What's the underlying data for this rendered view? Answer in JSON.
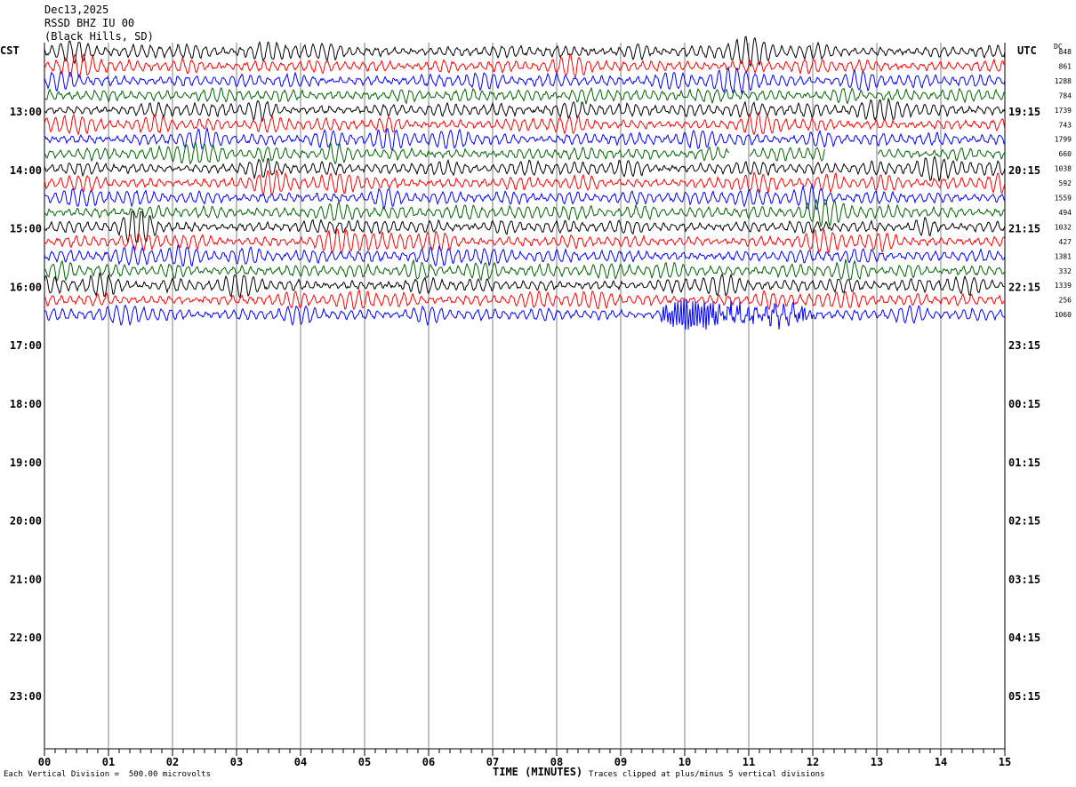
{
  "header": {
    "date": "Dec13,2025",
    "station": "RSSD BHZ IU 00",
    "location": "(Black Hills, SD)"
  },
  "chart_data": {
    "type": "line",
    "left_axis_label": "CST",
    "right_axis_label": "UTC",
    "dc_label": "DC",
    "x_axis_title": "TIME (MINUTES)",
    "x_ticks": [
      "00",
      "01",
      "02",
      "03",
      "04",
      "05",
      "06",
      "07",
      "08",
      "09",
      "10",
      "11",
      "12",
      "13",
      "14",
      "15"
    ],
    "xlim": [
      0,
      15
    ],
    "left_hour_labels": [
      "13:00",
      "14:00",
      "15:00",
      "16:00",
      "17:00",
      "18:00",
      "19:00",
      "20:00",
      "21:00",
      "22:00",
      "23:00"
    ],
    "right_hour_labels": [
      "19:15",
      "20:15",
      "21:15",
      "22:15",
      "23:15",
      "00:15",
      "01:15",
      "02:15",
      "03:15",
      "04:15",
      "05:15"
    ],
    "trace_colors": [
      "#000000",
      "#ff0000",
      "#0000ff",
      "#006400"
    ],
    "dc_offsets": [
      "848",
      "861",
      "1288",
      "784",
      "1739",
      "743",
      "1799",
      "660",
      "1038",
      "592",
      "1559",
      "494",
      "1032",
      "427",
      "1381",
      "332",
      "1339",
      "256",
      "1060"
    ],
    "event": {
      "trace_index": 18,
      "start_minute": 9.6,
      "end_minute": 12.0,
      "peak_minute": 10.1
    },
    "left_note": "Each Vertical Division =  500.00 microvolts",
    "right_note": "Traces clipped at plus/minus 5 vertical divisions"
  }
}
